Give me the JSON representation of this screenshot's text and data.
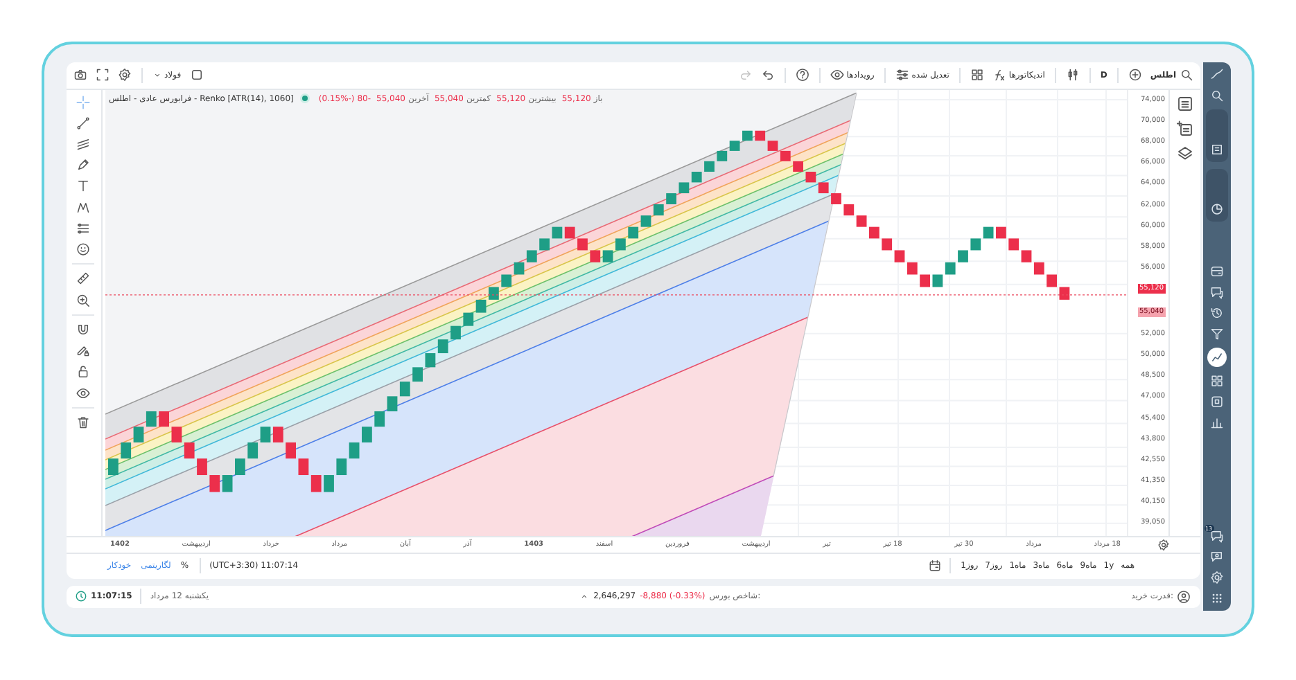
{
  "toolbar": {
    "symbol": "اطلس",
    "interval": "D",
    "indicators": "اندیکاتورها",
    "adjustment": "تعدیل شده",
    "events": "رویدادها",
    "compare_symbol": "فولاد",
    "undo": {
      "disabled": false
    },
    "redo": {
      "disabled": true
    }
  },
  "legend": {
    "symbol": "Renko [ATR(14), 1060] - فرابورس عادی - اطلس",
    "live": true,
    "ohlc": [
      {
        "label": "باز",
        "value": "55,120"
      },
      {
        "label": "بیشترین",
        "value": "55,120"
      },
      {
        "label": "کمترین",
        "value": "55,040"
      },
      {
        "label": "آخرین",
        "value": "55,040"
      }
    ],
    "change": "-80 (-0.15%)"
  },
  "drawing_tools": [
    [
      {
        "kind": "crosshair",
        "selected": true
      },
      {
        "kind": "line",
        "selected": false
      },
      {
        "kind": "fib",
        "selected": false
      },
      {
        "kind": "pen",
        "selected": false
      },
      {
        "kind": "text",
        "selected": false
      },
      {
        "kind": "pattern",
        "selected": false
      },
      {
        "kind": "measure",
        "selected": false
      },
      {
        "kind": "smiley",
        "selected": false
      }
    ],
    [
      {
        "kind": "ruler",
        "selected": false
      },
      {
        "kind": "zoom",
        "selected": false
      }
    ],
    [
      {
        "kind": "magnet",
        "selected": false
      },
      {
        "kind": "pencil-lock",
        "selected": false
      },
      {
        "kind": "lock",
        "selected": false
      },
      {
        "kind": "eye",
        "selected": false
      }
    ],
    [
      {
        "kind": "trash",
        "selected": false
      }
    ]
  ],
  "price_axis": [
    {
      "kind": "tick",
      "text": "74,000"
    },
    {
      "kind": "tick",
      "text": "70,000"
    },
    {
      "kind": "tick",
      "text": "68,000"
    },
    {
      "kind": "tick",
      "text": "66,000"
    },
    {
      "kind": "tick",
      "text": "64,000"
    },
    {
      "kind": "tick",
      "text": "62,000"
    },
    {
      "kind": "tick",
      "text": "60,000"
    },
    {
      "kind": "tick",
      "text": "58,000"
    },
    {
      "kind": "tick",
      "text": "56,000"
    },
    {
      "kind": "last",
      "text": "55,120"
    },
    {
      "kind": "close",
      "text": "55,040"
    },
    {
      "kind": "tick",
      "text": "52,000"
    },
    {
      "kind": "tick",
      "text": "50,000"
    },
    {
      "kind": "tick",
      "text": "48,500"
    },
    {
      "kind": "tick",
      "text": "47,000"
    },
    {
      "kind": "tick",
      "text": "45,400"
    },
    {
      "kind": "tick",
      "text": "43,800"
    },
    {
      "kind": "tick",
      "text": "42,550"
    },
    {
      "kind": "tick",
      "text": "41,350"
    },
    {
      "kind": "tick",
      "text": "40,150"
    },
    {
      "kind": "tick",
      "text": "39,050"
    }
  ],
  "panel_icons": [
    {
      "kind": "list"
    },
    {
      "kind": "list-add"
    },
    {
      "kind": "layers"
    }
  ],
  "time_axis": [
    {
      "text": "18 مرداد",
      "bold": false
    },
    {
      "text": "مرداد",
      "bold": false
    },
    {
      "text": "30 تیر",
      "bold": false
    },
    {
      "text": "18 تیر",
      "bold": false
    },
    {
      "text": "تیر",
      "bold": false
    },
    {
      "text": "اردیبهشت",
      "bold": false
    },
    {
      "text": "فروردین",
      "bold": false
    },
    {
      "text": "اسفند",
      "bold": false
    },
    {
      "text": "1403",
      "bold": true
    },
    {
      "text": "آذر",
      "bold": false
    },
    {
      "text": "آبان",
      "bold": false
    },
    {
      "text": "مرداد",
      "bold": false
    },
    {
      "text": "خرداد",
      "bold": false
    },
    {
      "text": "اردیبهشت",
      "bold": false
    },
    {
      "text": "1402",
      "bold": true
    }
  ],
  "scale_options": [
    {
      "label": "%",
      "on": false
    },
    {
      "label": "لگاریتمی",
      "on": true
    },
    {
      "label": "خودکار",
      "on": true
    }
  ],
  "clock_zone": "(UTC+3:30) 11:07:14",
  "ranges": [
    "همه",
    "1y",
    "9ماه",
    "6ماه",
    "3ماه",
    "1ماه",
    "7روز",
    "1روز"
  ],
  "status_bar": {
    "time": "11:07:15",
    "date": "یکشنبه 12 مرداد",
    "index_label": "شاخص بورس:",
    "index_value": "2,646,297",
    "index_change": "-8,880 (-0.33%)",
    "buying_power_label": "قدرت خرید:"
  },
  "nav": {
    "top": [
      {
        "kind": "logo",
        "selected": false
      },
      {
        "kind": "search",
        "selected": false
      },
      {
        "kind": "tab-watch",
        "selected": false
      },
      {
        "kind": "tab-portfolio",
        "selected": false
      }
    ],
    "middle": [
      {
        "kind": "wallet",
        "selected": false
      },
      {
        "kind": "chat",
        "selected": false
      },
      {
        "kind": "history",
        "selected": false
      },
      {
        "kind": "funnel",
        "selected": false
      },
      {
        "kind": "chart",
        "selected": true
      },
      {
        "kind": "grid",
        "selected": false
      },
      {
        "kind": "box",
        "selected": false
      },
      {
        "kind": "bars",
        "selected": false
      }
    ],
    "bottom": [
      {
        "kind": "chat",
        "selected": false,
        "badge": "13"
      },
      {
        "kind": "chat-gear",
        "selected": false
      },
      {
        "kind": "settings",
        "selected": false
      },
      {
        "kind": "dots",
        "selected": false
      }
    ]
  }
}
